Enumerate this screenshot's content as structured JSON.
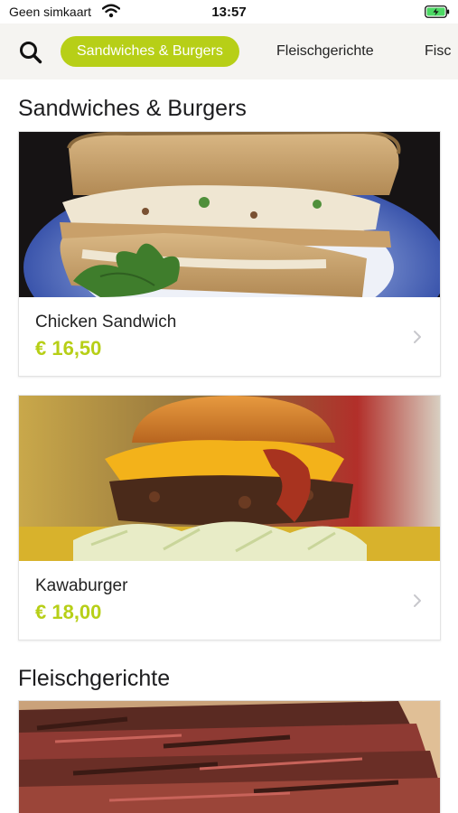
{
  "status_bar": {
    "carrier": "Geen simkaart",
    "time": "13:57"
  },
  "nav": {
    "active_category": "Sandwiches & Burgers",
    "categories": [
      "Fleischgerichte",
      "Fisc"
    ]
  },
  "sections": [
    {
      "title": "Sandwiches & Burgers",
      "items": [
        {
          "name": "Chicken Sandwich",
          "price": "€ 16,50"
        },
        {
          "name": "Kawaburger",
          "price": "€ 18,00"
        }
      ]
    },
    {
      "title": "Fleischgerichte"
    }
  ],
  "colors": {
    "accent": "#b7cf17",
    "nav_bg": "#f5f4f1"
  },
  "icons": [
    "wifi-icon",
    "battery-charging-icon",
    "search-icon",
    "chevron-right-icon"
  ]
}
